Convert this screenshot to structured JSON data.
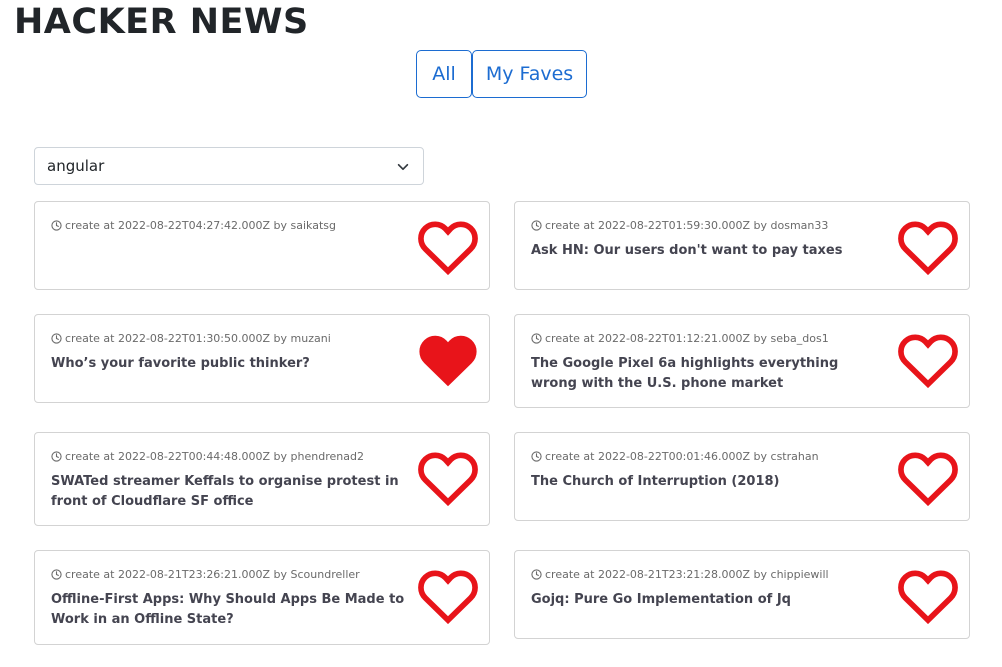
{
  "header": {
    "title": "HACKER NEWS"
  },
  "tabs": {
    "all": "All",
    "faves": "My Faves"
  },
  "filter": {
    "selected": "angular",
    "icon": "chevron-down-icon"
  },
  "colors": {
    "accent": "#1c6cd1",
    "heart": "#e8141a",
    "meta": "#6a6a6a",
    "title": "#444450"
  },
  "cards": [
    {
      "meta": "create at 2022-08-22T04:27:42.000Z by saikatsg",
      "title": "",
      "favorite": false
    },
    {
      "meta": "create at 2022-08-22T01:59:30.000Z by dosman33",
      "title": "Ask HN: Our users don't want to pay taxes",
      "favorite": false
    },
    {
      "meta": "create at 2022-08-22T01:30:50.000Z by muzani",
      "title": "Who’s your favorite public thinker?",
      "favorite": true
    },
    {
      "meta": "create at 2022-08-22T01:12:21.000Z by seba_dos1",
      "title": "The Google Pixel 6a highlights everything wrong with the U.S. phone market",
      "favorite": false
    },
    {
      "meta": "create at 2022-08-22T00:44:48.000Z by phendrenad2",
      "title": "SWATed streamer Keffals to organise protest in front of Cloudflare SF office",
      "favorite": false
    },
    {
      "meta": "create at 2022-08-22T00:01:46.000Z by cstrahan",
      "title": "The Church of Interruption (2018)",
      "favorite": false
    },
    {
      "meta": "create at 2022-08-21T23:26:21.000Z by Scoundreller",
      "title": "Offline-First Apps: Why Should Apps Be Made to Work in an Offline State?",
      "favorite": false
    },
    {
      "meta": "create at 2022-08-21T23:21:28.000Z by chippiewill",
      "title": "Gojq: Pure Go Implementation of Jq",
      "favorite": false
    }
  ]
}
